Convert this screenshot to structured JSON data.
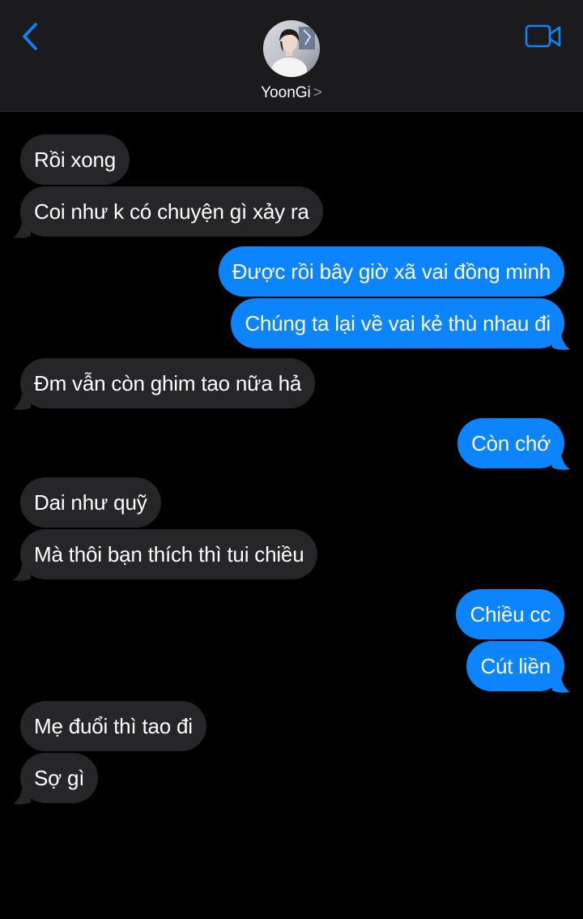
{
  "header": {
    "contact_name": "YoonGi",
    "chevron": ">"
  },
  "colors": {
    "accent": "#0b84fe",
    "received_bubble": "#262628",
    "header_bg": "#1b1b1d"
  },
  "messages": [
    {
      "dir": "recv",
      "text": "Rồi xong",
      "tail": false
    },
    {
      "dir": "recv",
      "text": "Coi như k có chuyện gì xảy ra",
      "tail": true
    },
    {
      "dir": "sent",
      "text": "Được rồi bây giờ xã vai đồng minh",
      "tail": false
    },
    {
      "dir": "sent",
      "text": "Chúng ta lại về vai kẻ thù nhau đi",
      "tail": true
    },
    {
      "dir": "recv",
      "text": "Đm vẫn còn ghim tao nữa hả",
      "tail": true
    },
    {
      "dir": "sent",
      "text": "Còn chớ",
      "tail": true
    },
    {
      "dir": "recv",
      "text": "Dai như quỹ",
      "tail": false
    },
    {
      "dir": "recv",
      "text": "Mà thôi bạn thích thì tui chiều",
      "tail": true
    },
    {
      "dir": "sent",
      "text": "Chiều cc",
      "tail": false
    },
    {
      "dir": "sent",
      "text": "Cút liền",
      "tail": true
    },
    {
      "dir": "recv",
      "text": "Mẹ đuổi thì tao đi",
      "tail": false
    },
    {
      "dir": "recv",
      "text": "Sợ gì",
      "tail": true
    }
  ]
}
